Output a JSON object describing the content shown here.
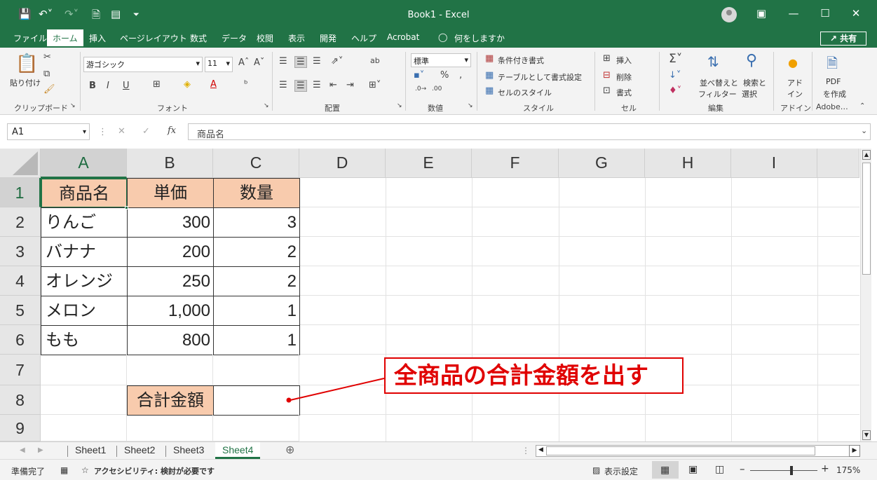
{
  "app": {
    "title": "Book1  -  Excel",
    "colors": {
      "brand": "#217346",
      "header_fill": "#f8cbad",
      "callout": "#e00000"
    }
  },
  "quick_access": [
    "save-icon",
    "undo-icon",
    "redo-icon",
    "print-preview-icon",
    "form-icon",
    "customize-icon"
  ],
  "menu": {
    "tabs": [
      "ファイル",
      "ホーム",
      "挿入",
      "ページレイアウト",
      "数式",
      "データ",
      "校閲",
      "表示",
      "開発",
      "ヘルプ",
      "Acrobat"
    ],
    "tell_me": "何をしますか",
    "share": "共有"
  },
  "ribbon": {
    "clipboard": {
      "paste": "貼り付け",
      "group": "クリップボード"
    },
    "font": {
      "name": "游ゴシック",
      "size": "11",
      "group": "フォント"
    },
    "alignment": {
      "group": "配置"
    },
    "number": {
      "format": "標準",
      "group": "数値"
    },
    "styles": {
      "conditional": "条件付き書式",
      "table": "テーブルとして書式設定",
      "cell_styles": "セルのスタイル",
      "group": "スタイル"
    },
    "cells": {
      "insert": "挿入",
      "delete": "削除",
      "format": "書式",
      "group": "セル"
    },
    "editing": {
      "sort": "並べ替えと",
      "filter": "フィルター",
      "find": "検索と",
      "select": "選択",
      "group": "編集"
    },
    "addins": {
      "label1": "アド",
      "label2": "イン",
      "group": "アドイン"
    },
    "adobe": {
      "label1": "PDF",
      "label2": "を作成",
      "group": "Adobe…"
    }
  },
  "formula_bar": {
    "name_box": "A1",
    "content": "商品名"
  },
  "columns": [
    "A",
    "B",
    "C",
    "D",
    "E",
    "F",
    "G",
    "H",
    "I"
  ],
  "rows": [
    "1",
    "2",
    "3",
    "4",
    "5",
    "6",
    "7",
    "8",
    "9"
  ],
  "table": {
    "headers": [
      "商品名",
      "単価",
      "数量"
    ],
    "rows": [
      [
        "りんご",
        "300",
        "3"
      ],
      [
        "バナナ",
        "200",
        "2"
      ],
      [
        "オレンジ",
        "250",
        "2"
      ],
      [
        "メロン",
        "1,000",
        "1"
      ],
      [
        "もも",
        "800",
        "1"
      ]
    ],
    "total_label": "合計金額"
  },
  "callout": {
    "text": "全商品の合計金額を出す"
  },
  "sheets": {
    "tabs": [
      "Sheet1",
      "Sheet2",
      "Sheet3",
      "Sheet4"
    ],
    "active": "Sheet4"
  },
  "status": {
    "ready": "準備完了",
    "accessibility": "アクセシビリティ: 検討が必要です",
    "display_settings": "表示設定",
    "zoom": "175%"
  }
}
